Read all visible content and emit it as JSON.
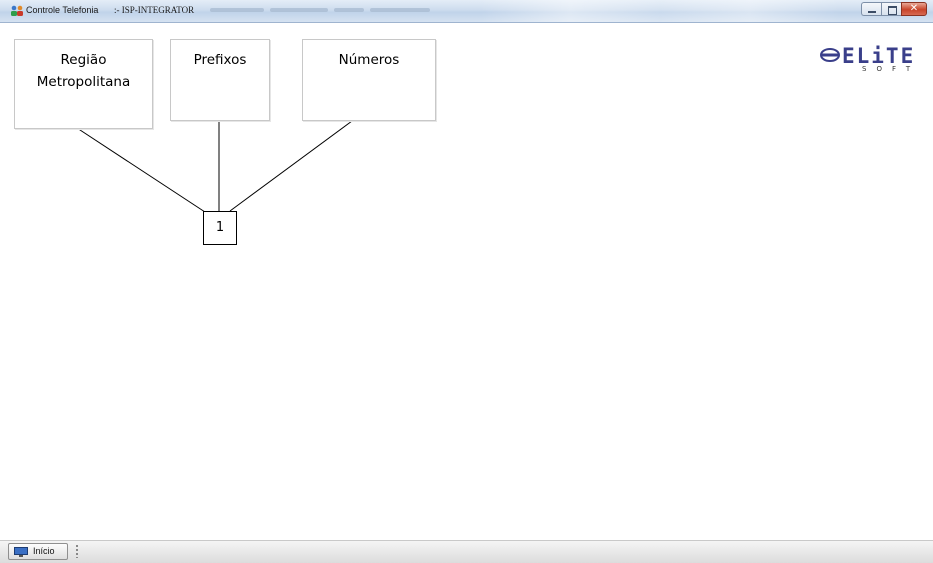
{
  "window": {
    "app_name": "Controle Telefonia",
    "title": ":- ISP-INTEGRATOR",
    "icons": [
      "app-icon",
      "minimize-icon",
      "maximize-icon",
      "close-icon"
    ]
  },
  "diagram": {
    "cards": [
      {
        "lines": [
          "Região",
          "Metropolitana"
        ]
      },
      {
        "lines": [
          "Prefixos"
        ]
      },
      {
        "lines": [
          "Números"
        ]
      }
    ],
    "hub_label": "1"
  },
  "logo": {
    "wordmark": "ELiTE",
    "sub": "SOFT",
    "color": "#3a3f8a"
  },
  "taskbar": {
    "start_label": "Início",
    "start_icon": "monitor-icon"
  }
}
